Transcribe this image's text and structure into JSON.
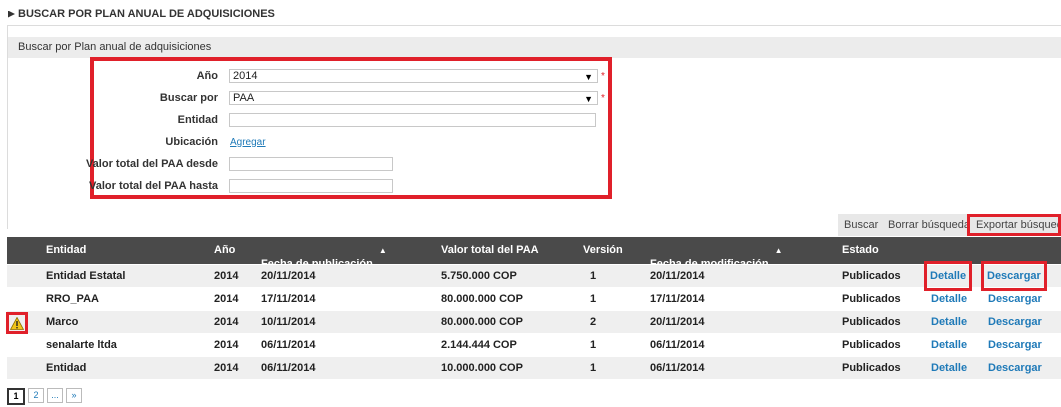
{
  "page_title": "BUSCAR POR PLAN ANUAL DE ADQUISICIONES",
  "panel_header": "Buscar por Plan anual de adquisiciones",
  "form": {
    "anio_label": "Año",
    "anio_value": "2014",
    "buscar_por_label": "Buscar por",
    "buscar_por_value": "PAA",
    "entidad_label": "Entidad",
    "entidad_value": "",
    "ubicacion_label": "Ubicación",
    "ubicacion_link": "Agregar",
    "valor_desde_label": "Valor total del PAA desde",
    "valor_desde_value": "",
    "valor_hasta_label": "Valor total del PAA hasta",
    "valor_hasta_value": "",
    "required_mark": "*"
  },
  "toolbar": {
    "buscar": "Buscar",
    "borrar": "Borrar búsqueda",
    "exportar": "Exportar búsqueda"
  },
  "table": {
    "columns": [
      "Entidad",
      "Año",
      "Fecha de publicación",
      "Valor total del PAA",
      "Versión",
      "Fecha de modificación",
      "Estado"
    ],
    "rows": [
      {
        "entidad": "Entidad Estatal",
        "anio": "2014",
        "fecha_pub": "20/11/2014",
        "valor": "5.750.000 COP",
        "version": "1",
        "fecha_mod": "20/11/2014",
        "estado": "Publicados",
        "detalle": "Detalle",
        "descargar": "Descargar"
      },
      {
        "entidad": "RRO_PAA",
        "anio": "2014",
        "fecha_pub": "17/11/2014",
        "valor": "80.000.000 COP",
        "version": "1",
        "fecha_mod": "17/11/2014",
        "estado": "Publicados",
        "detalle": "Detalle",
        "descargar": "Descargar"
      },
      {
        "entidad": "Marco",
        "anio": "2014",
        "fecha_pub": "10/11/2014",
        "valor": "80.000.000 COP",
        "version": "2",
        "fecha_mod": "20/11/2014",
        "estado": "Publicados",
        "detalle": "Detalle",
        "descargar": "Descargar"
      },
      {
        "entidad": "senalarte ltda",
        "anio": "2014",
        "fecha_pub": "06/11/2014",
        "valor": "2.144.444 COP",
        "version": "1",
        "fecha_mod": "06/11/2014",
        "estado": "Publicados",
        "detalle": "Detalle",
        "descargar": "Descargar"
      },
      {
        "entidad": "Entidad",
        "anio": "2014",
        "fecha_pub": "06/11/2014",
        "valor": "10.000.000 COP",
        "version": "1",
        "fecha_mod": "06/11/2014",
        "estado": "Publicados",
        "detalle": "Detalle",
        "descargar": "Descargar"
      }
    ]
  },
  "pager": {
    "p1": "1",
    "p2": "2",
    "ellipsis": "...",
    "next": "»"
  },
  "colors": {
    "highlight": "#e0202a",
    "link": "#1f7ab8",
    "header_bg": "#4a4a4a"
  }
}
